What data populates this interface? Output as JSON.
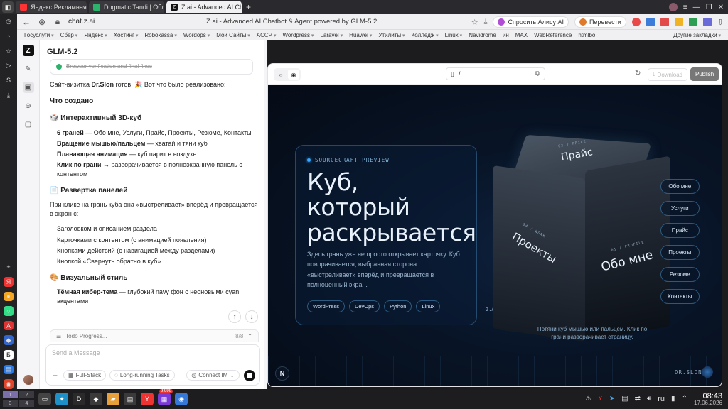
{
  "browser": {
    "tabs": [
      {
        "label": "Яндекс Рекламная сеть",
        "icon": "yandex-icon",
        "color": "#ff3333"
      },
      {
        "label": "Dogmatic Tandi | Облачна",
        "icon": "cloud-icon",
        "color": "#2bb36b"
      },
      {
        "label": "Z.ai - Advanced AI Chat",
        "icon": "zai-icon",
        "color": "#111111"
      }
    ],
    "url": "chat.z.ai",
    "page_title": "Z.ai - Advanced AI Chatbot & Agent powered by GLM-5.2",
    "alice_button": "Спросить Алису AI",
    "translate_button": "Перевести",
    "bookmarks": [
      "Госуслуги",
      "Сбер",
      "Яндекс",
      "Хостинг",
      "Robokassa",
      "Wordops",
      "Мои Сайты",
      "ACCP",
      "Wordpress",
      "Laravel",
      "Huawei",
      "Утилиты",
      "Колледж",
      "Linux",
      "Navidrome",
      "ин",
      "MAX",
      "WebReference",
      "htmlbo"
    ],
    "bookmarks_other": "Другие закладки"
  },
  "chat": {
    "model": "GLM-5.2",
    "done_task": "Browser verification and final fixes",
    "intro_prefix": "Сайт-визитка ",
    "intro_name": "Dr.Slon",
    "intro_suffix": " готов! 🎉 Вот что было реализовано:",
    "created_heading": "Что создано",
    "cube_heading": "🎲 Интерактивный 3D-куб",
    "cube_items": [
      {
        "bold": "6 граней",
        "text": " — Обо мне, Услуги, Прайс, Проекты, Резюме, Контакты"
      },
      {
        "bold": "Вращение мышью/пальцем",
        "text": " — хватай и тяни куб"
      },
      {
        "bold": "Плавающая анимация",
        "text": " — куб парит в воздухе"
      },
      {
        "bold": "Клик по грани",
        "text": " → разворачивается в полноэкранную панель с контентом"
      }
    ],
    "panel_heading": "📄 Развертка панелей",
    "panel_text": "При клике на грань куба она «выстреливает» вперёд и превращается в экран с:",
    "panel_items": [
      "Заголовком и описанием раздела",
      "Карточками с контентом (с анимацией появления)",
      "Кнопками действий (с навигацией между разделами)",
      "Кнопкой «Свернуть обратно в куб»"
    ],
    "style_heading": "🎨 Визуальный стиль",
    "style_items": [
      {
        "bold": "Тёмная кибер-тема",
        "text": " — глубокий navy фон с неоновыми cyan акцентами"
      }
    ],
    "todo_label": "Todo Progress...",
    "todo_count": "8/8",
    "input_placeholder": "Send a Message",
    "fullstack_label": "Full-Stack",
    "longrunning_label": "Long-running Tasks",
    "connect_label": "Connect IM"
  },
  "preview": {
    "path": "/",
    "download_label": "Download",
    "publish_label": "Publish",
    "site": {
      "badge": "SOURCECRAFT PREVIEW",
      "title_line1": "Куб,",
      "title_line2": "который",
      "title_line3": "раскрывается",
      "description": "Здесь грань уже не просто открывает карточку. Куб поворачивается, выбранная сторона «выстреливает» вперёд и превращается в полноценный экран.",
      "tags": [
        "WordPress",
        "DevOps",
        "Python",
        "Linux"
      ],
      "zai_mark": "Z.Ai",
      "face_price": "Прайс",
      "face_price_small": "03 / PRICE",
      "face_projects": "Проекты",
      "face_projects_small": "04 / WORK",
      "face_about": "Обо мне",
      "face_about_small": "01 / PROFILE",
      "nav": [
        "Обо мне",
        "Услуги",
        "Прайс",
        "Проекты",
        "Резюме",
        "Контакты"
      ],
      "hint": "Потяни куб мышью или пальцем. Клик по грани разворачивает страницу.",
      "n_button": "N",
      "brand": "DR.SLON"
    }
  },
  "taskbar": {
    "desktops": [
      "1",
      "2",
      "3",
      "4"
    ],
    "badge": "9,999",
    "lang": "ru",
    "time": "08:43",
    "date": "17.06.2026"
  }
}
